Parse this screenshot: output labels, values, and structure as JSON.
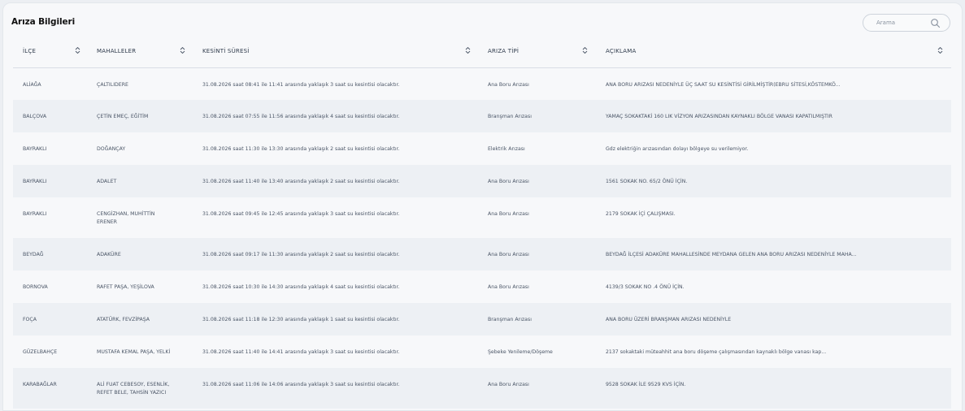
{
  "header": {
    "title": "Arıza Bilgileri"
  },
  "search": {
    "placeholder": "Arama",
    "value": "",
    "icon": "search-icon"
  },
  "table": {
    "columns": [
      "İLÇE",
      "MAHALLELER",
      "KESİNTİ SÜRESİ",
      "ARIZA TİPİ",
      "AÇIKLAMA"
    ],
    "rows": [
      {
        "ilce": "ALİAĞA",
        "mahalle": [
          "ÇALTILIDERE"
        ],
        "sure": "31.08.2026 saat 08:41 ile 11:41 arasında yaklaşık 3 saat su kesintisi olacaktır.",
        "tip": "Ana Boru Arızası",
        "aciklama": "ANA BORU ARIZASI NEDENİYLE ÜÇ SAAT SU KESİNTİSİ GİRİLMİŞTİR(EBRU SİTESİ,KÖSTEMKÖ..."
      },
      {
        "ilce": "BALÇOVA",
        "mahalle": [
          "ÇETİN EMEÇ, EĞİTİM"
        ],
        "sure": "31.08.2026 saat 07:55 ile 11:56 arasında yaklaşık 4 saat su kesintisi olacaktır.",
        "tip": "Branşman Arızası",
        "aciklama": "YAMAÇ SOKAKTAKİ 160 LIK VİZYON ARIZASINDAN KAYNAKLI BÖLGE VANASI KAPATILMIŞTIR"
      },
      {
        "ilce": "BAYRAKLI",
        "mahalle": [
          "DOĞANÇAY"
        ],
        "sure": "31.08.2026 saat 11:30 ile 13:30 arasında yaklaşık 2 saat su kesintisi olacaktır.",
        "tip": "Elektrik Arızası",
        "aciklama": "Gdz elektriğin arızasından dolayı bölgeye su verilemiyor."
      },
      {
        "ilce": "BAYRAKLI",
        "mahalle": [
          "ADALET"
        ],
        "sure": "31.08.2026 saat 11:40 ile 13:40 arasında yaklaşık 2 saat su kesintisi olacaktır.",
        "tip": "Ana Boru Arızası",
        "aciklama": "1561 SOKAK NO. 65/2 ÖNÜ İÇİN."
      },
      {
        "ilce": "BAYRAKLI",
        "mahalle": [
          "CENGİZHAN, MUHİTTİN",
          "ERENER"
        ],
        "sure": "31.08.2026 saat 09:45 ile 12:45 arasında yaklaşık 3 saat su kesintisi olacaktır.",
        "tip": "Ana Boru Arızası",
        "aciklama": "2179 SOKAK İÇİ ÇALIŞMASI."
      },
      {
        "ilce": "BEYDAĞ",
        "mahalle": [
          "ADAKÜRE"
        ],
        "sure": "31.08.2026 saat 09:17 ile 11:30 arasında yaklaşık 2 saat su kesintisi olacaktır.",
        "tip": "Ana Boru Arızası",
        "aciklama": "BEYDAĞ İLÇESİ ADAKÜRE MAHALLESİNDE MEYDANA GELEN ANA BORU ARIZASI NEDENİYLE MAHA..."
      },
      {
        "ilce": "BORNOVA",
        "mahalle": [
          "RAFET PAŞA, YEŞİLOVA"
        ],
        "sure": "31.08.2026 saat 10:30 ile 14:30 arasında yaklaşık 4 saat su kesintisi olacaktır.",
        "tip": "Ana Boru Arızası",
        "aciklama": "4139/3 SOKAK NO .4 ÖNÜ İÇİN."
      },
      {
        "ilce": "FOÇA",
        "mahalle": [
          "ATATÜRK, FEVZİPAŞA"
        ],
        "sure": "31.08.2026 saat 11:18 ile 12:30 arasında yaklaşık 1 saat su kesintisi olacaktır.",
        "tip": "Branşman Arızası",
        "aciklama": "ANA BORU ÜZERİ BRANŞMAN ARIZASI NEDENİYLE"
      },
      {
        "ilce": "GÜZELBAHÇE",
        "mahalle": [
          "MUSTAFA KEMAL PAŞA, YELKİ"
        ],
        "sure": "31.08.2026 saat 11:40 ile 14:41 arasında yaklaşık 3 saat su kesintisi olacaktır.",
        "tip": "Şebeke Yenileme/Döşeme",
        "aciklama": "2137 sokaktaki müteahhit ana boru döşeme çalışmasından kaynaklı bölge vanası kap..."
      },
      {
        "ilce": "KARABAĞLAR",
        "mahalle": [
          "ALİ FUAT CEBESOY, ESENLİK,",
          "REFET BELE, TAHSİN YAZICI"
        ],
        "sure": "31.08.2026 saat 11:06 ile 14:06 arasında yaklaşık 3 saat su kesintisi olacaktır.",
        "tip": "Ana Boru Arızası",
        "aciklama": "9528 SOKAK İLE 9529 KVS İÇİN."
      }
    ]
  },
  "colors": {
    "accent": "#2e3a4b",
    "row_alt": "#edf0f4",
    "card_bg": "#f7f8fa"
  }
}
